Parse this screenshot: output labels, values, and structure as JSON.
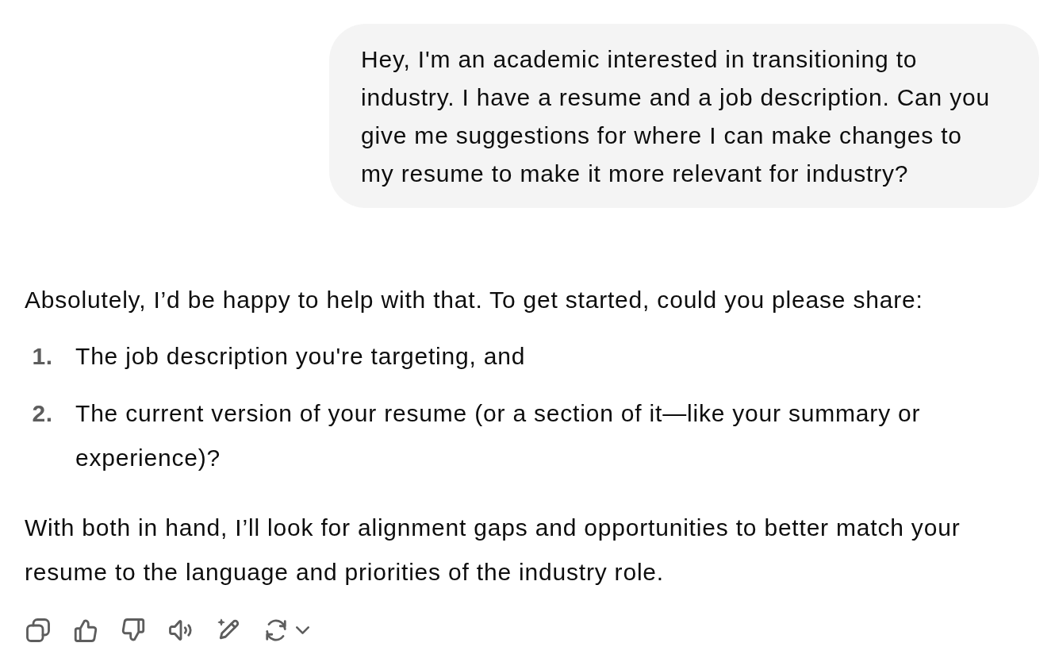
{
  "user_message": {
    "text": "Hey, I'm an academic interested in transitioning to industry. I have a resume and a job description. Can you give me suggestions for where I can make changes to my resume to make it more relevant for industry?"
  },
  "assistant_message": {
    "intro": "Absolutely, I’d be happy to help with that. To get started, could you please share:",
    "list": [
      {
        "number": "1.",
        "text": "The job description you're targeting, and"
      },
      {
        "number": "2.",
        "text": "The current version of your resume (or a section of it—like your summary or experience)?"
      }
    ],
    "closing": "With both in hand, I’ll look for alignment gaps and opportunities to better match your resume to the language and priorities of the industry role."
  }
}
